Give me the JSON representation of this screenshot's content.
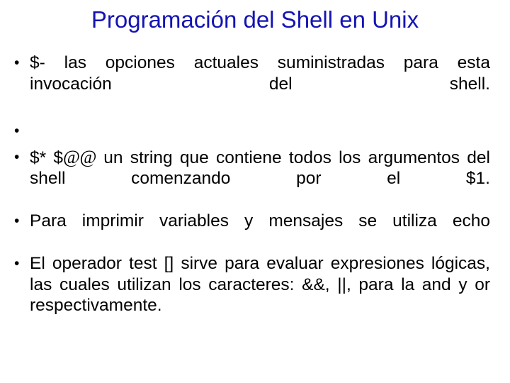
{
  "slide": {
    "title": "Programación del Shell en Unix",
    "title_color": "#1414b4",
    "background_color": "#ffffff",
    "text_color": "#000000",
    "bullets": [
      {
        "id": "bullet-options",
        "text": "$- las opciones actuales suministradas para esta invocación del shell.",
        "justified": true,
        "empty": false
      },
      {
        "id": "bullet-empty",
        "text": "",
        "justified": false,
        "empty": true
      },
      {
        "id": "bullet-all-args",
        "text_before_at": "$* $",
        "at_glyph": "@@",
        "text_after_at": " un string que contiene todos los argumentos del shell comenzando por el $1.",
        "text": "$* $@@ un string que contiene todos los argumentos del shell comenzando por el $1.",
        "justified": true,
        "empty": false
      },
      {
        "id": "bullet-echo",
        "text": "Para imprimir variables y mensajes se utiliza echo",
        "justified": true,
        "empty": false
      },
      {
        "id": "bullet-test-operator",
        "text": "El operador test [] sirve para evaluar expresiones lógicas, las cuales utilizan los caracteres: &&, ||, para la and y or respectivamente.",
        "justified": true,
        "empty": false
      }
    ]
  }
}
